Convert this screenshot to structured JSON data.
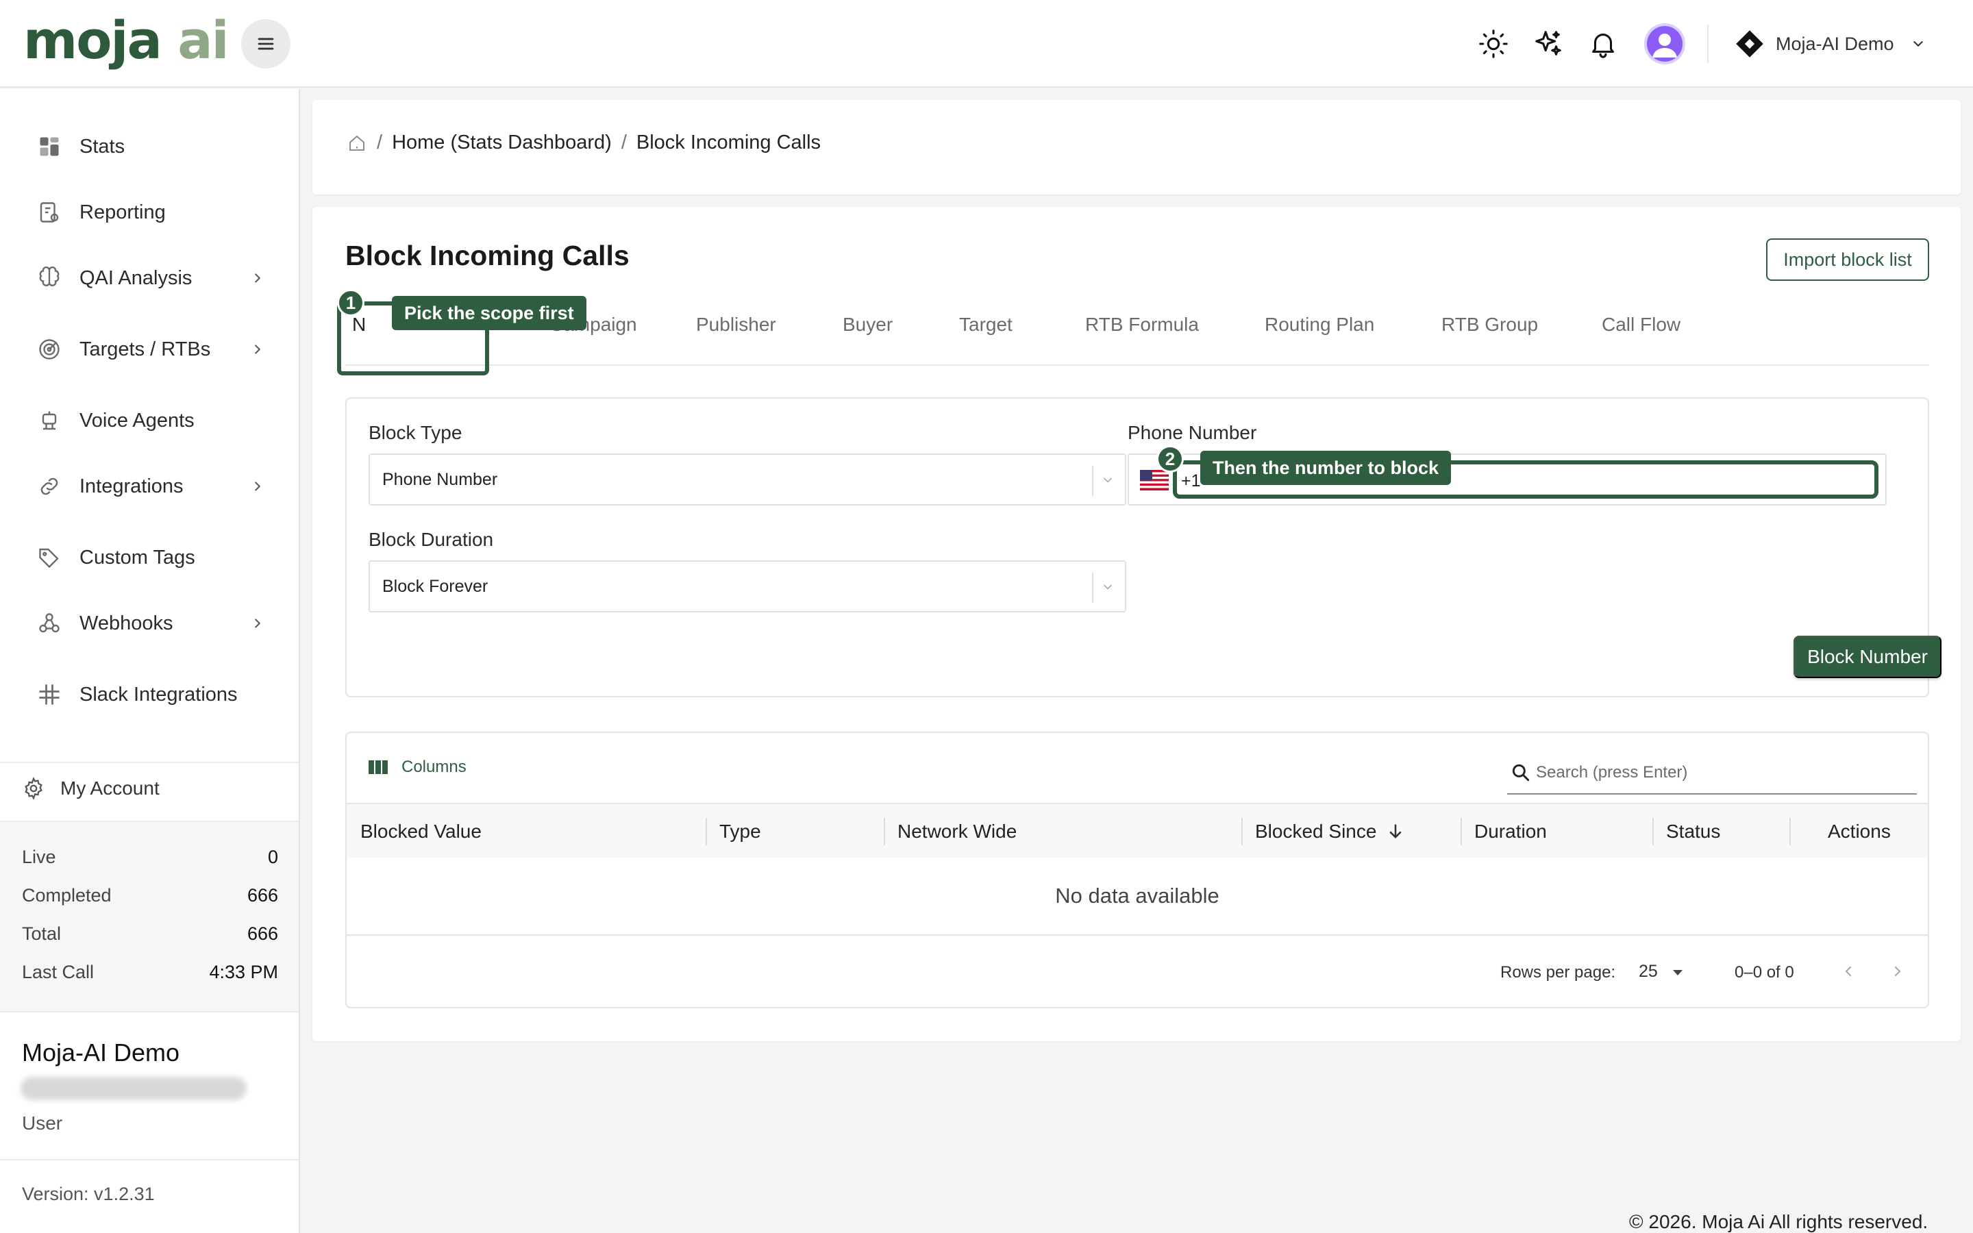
{
  "brand": {
    "logo_part1": "moja",
    "logo_part2": "ai"
  },
  "topbar": {
    "icons": [
      "sun-icon",
      "sparkles-icon",
      "bell-icon",
      "user-avatar"
    ],
    "org_label": "Moja-AI Demo"
  },
  "sidebar": {
    "items": [
      {
        "label": "Stats",
        "icon": "dashboard-icon",
        "has_children": false
      },
      {
        "label": "Reporting",
        "icon": "report-icon",
        "has_children": false
      },
      {
        "label": "QAI Analysis",
        "icon": "brain-icon",
        "has_children": true
      },
      {
        "label": "Targets / RTBs",
        "icon": "target-icon",
        "has_children": true
      },
      {
        "label": "Voice Agents",
        "icon": "robot-icon",
        "has_children": false
      },
      {
        "label": "Integrations",
        "icon": "link-icon",
        "has_children": true
      },
      {
        "label": "Custom Tags",
        "icon": "tag-icon",
        "has_children": false
      },
      {
        "label": "Webhooks",
        "icon": "webhook-icon",
        "has_children": true
      },
      {
        "label": "Slack Integrations",
        "icon": "slack-icon",
        "has_children": false
      }
    ],
    "my_account": "My Account",
    "stats": [
      {
        "label": "Live",
        "value": "0"
      },
      {
        "label": "Completed",
        "value": "666"
      },
      {
        "label": "Total",
        "value": "666"
      },
      {
        "label": "Last Call",
        "value": "4:33 PM"
      }
    ],
    "org_name": "Moja-AI Demo",
    "role": "User",
    "version": "Version: v1.2.31"
  },
  "breadcrumb": {
    "home_icon": "home-icon",
    "items": [
      "Home (Stats Dashboard)",
      "Block Incoming Calls"
    ]
  },
  "page": {
    "title": "Block Incoming Calls",
    "import_button": "Import block list",
    "tabs": [
      "N",
      "Campaign",
      "Publisher",
      "Buyer",
      "Target",
      "RTB Formula",
      "Routing Plan",
      "RTB Group",
      "Call Flow"
    ],
    "active_tab_index": 0
  },
  "hints": {
    "step1_number": "1",
    "step1_text": "Pick the scope first",
    "step2_number": "2",
    "step2_text": "Then the number to block"
  },
  "form": {
    "block_type_label": "Block Type",
    "block_type_value": "Phone Number",
    "block_duration_label": "Block Duration",
    "block_duration_value": "Block Forever",
    "phone_label": "Phone Number",
    "phone_country": "US",
    "phone_dial_code": "+1",
    "submit_label": "Block Number"
  },
  "table": {
    "columns_button": "Columns",
    "search_placeholder": "Search (press Enter)",
    "headers": [
      "Blocked Value",
      "Type",
      "Network Wide",
      "Blocked Since",
      "Duration",
      "Status",
      "Actions"
    ],
    "sorted_column": "Blocked Since",
    "sort_direction": "descending",
    "empty_text": "No data available",
    "rows_per_page_label": "Rows per page:",
    "rows_per_page": "25",
    "range_text": "0–0 of 0"
  },
  "footer": {
    "copyright": "© 2026. Moja Ai All rights reserved."
  },
  "colors": {
    "accent": "#2f5d3f",
    "logo_light": "#8ea888",
    "avatar": "#8b5cf6"
  }
}
